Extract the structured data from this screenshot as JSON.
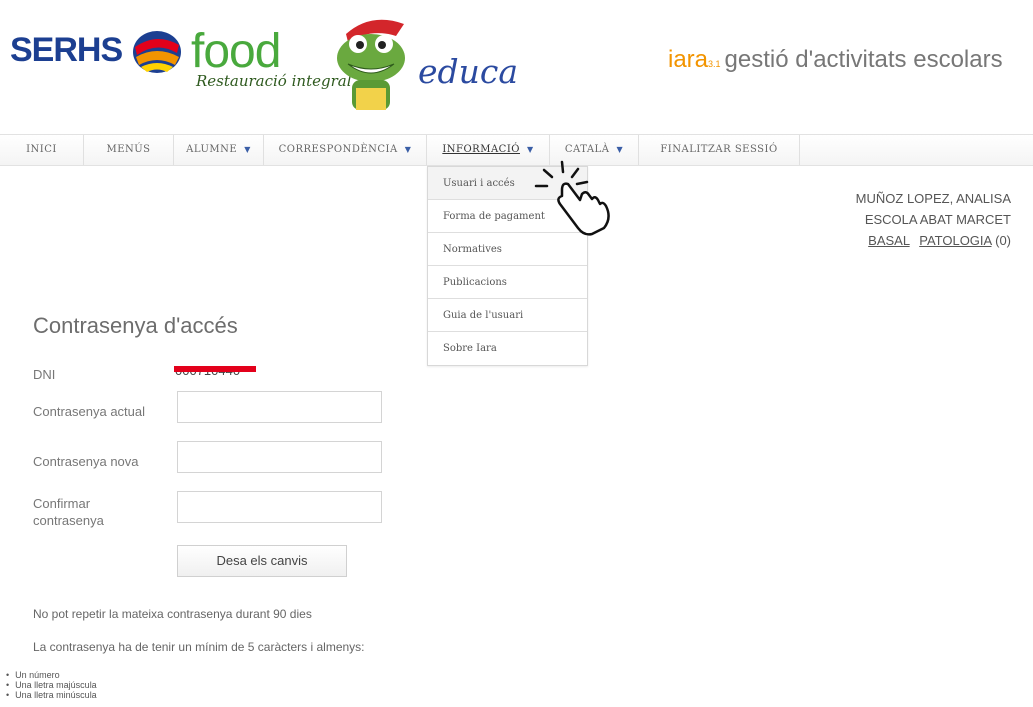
{
  "header": {
    "brand_serhs": "SERHS",
    "brand_food": "food",
    "brand_tagline": "Restauració integral",
    "brand_educa": "educa",
    "app_name": "iara",
    "app_version": "3.1",
    "app_subtitle": "gestió d'activitats escolars"
  },
  "nav": {
    "items": [
      {
        "label": "INICI",
        "caret": ""
      },
      {
        "label": "MENÚS",
        "caret": ""
      },
      {
        "label": "ALUMNE",
        "caret": "▼"
      },
      {
        "label": "CORRESPONDÈNCIA",
        "caret": "▼"
      },
      {
        "label": "INFORMACIÓ",
        "caret": "▼"
      },
      {
        "label": "CATALÀ",
        "caret": "▼"
      },
      {
        "label": "FINALITZAR SESSIÓ",
        "caret": ""
      }
    ]
  },
  "dropdown": {
    "items": [
      "Usuari i accés",
      "Forma de pagament",
      "Normatives",
      "Publicacions",
      "Guia de l'usuari",
      "Sobre Iara"
    ]
  },
  "user": {
    "name": "MUÑOZ LOPEZ, ANALISA",
    "school": "ESCOLA ABAT MARCET",
    "link_basal": "BASAL",
    "link_patologia": "PATOLOGIA",
    "patologia_count": "(0)"
  },
  "form": {
    "title": "Contrasenya d'accés",
    "dni_label": "DNI",
    "dni_value": "000710440",
    "current_label": "Contrasenya actual",
    "new_label": "Contrasenya nova",
    "confirm_label_line1": "Confirmar",
    "confirm_label_line2": "contrasenya",
    "save_button": "Desa els canvis"
  },
  "notes": {
    "repeat": "No pot repetir la mateixa contrasenya durant 90 dies",
    "min": "La contrasenya ha de tenir un mínim de 5 caràcters i almenys:",
    "rules": [
      "Un número",
      "Una lletra majúscula",
      "Una lletra minúscula"
    ]
  },
  "colors": {
    "brand_blue": "#1c3f91",
    "food_green": "#49a93d",
    "iara_orange": "#f29400",
    "redaction_red": "#e3001b"
  }
}
